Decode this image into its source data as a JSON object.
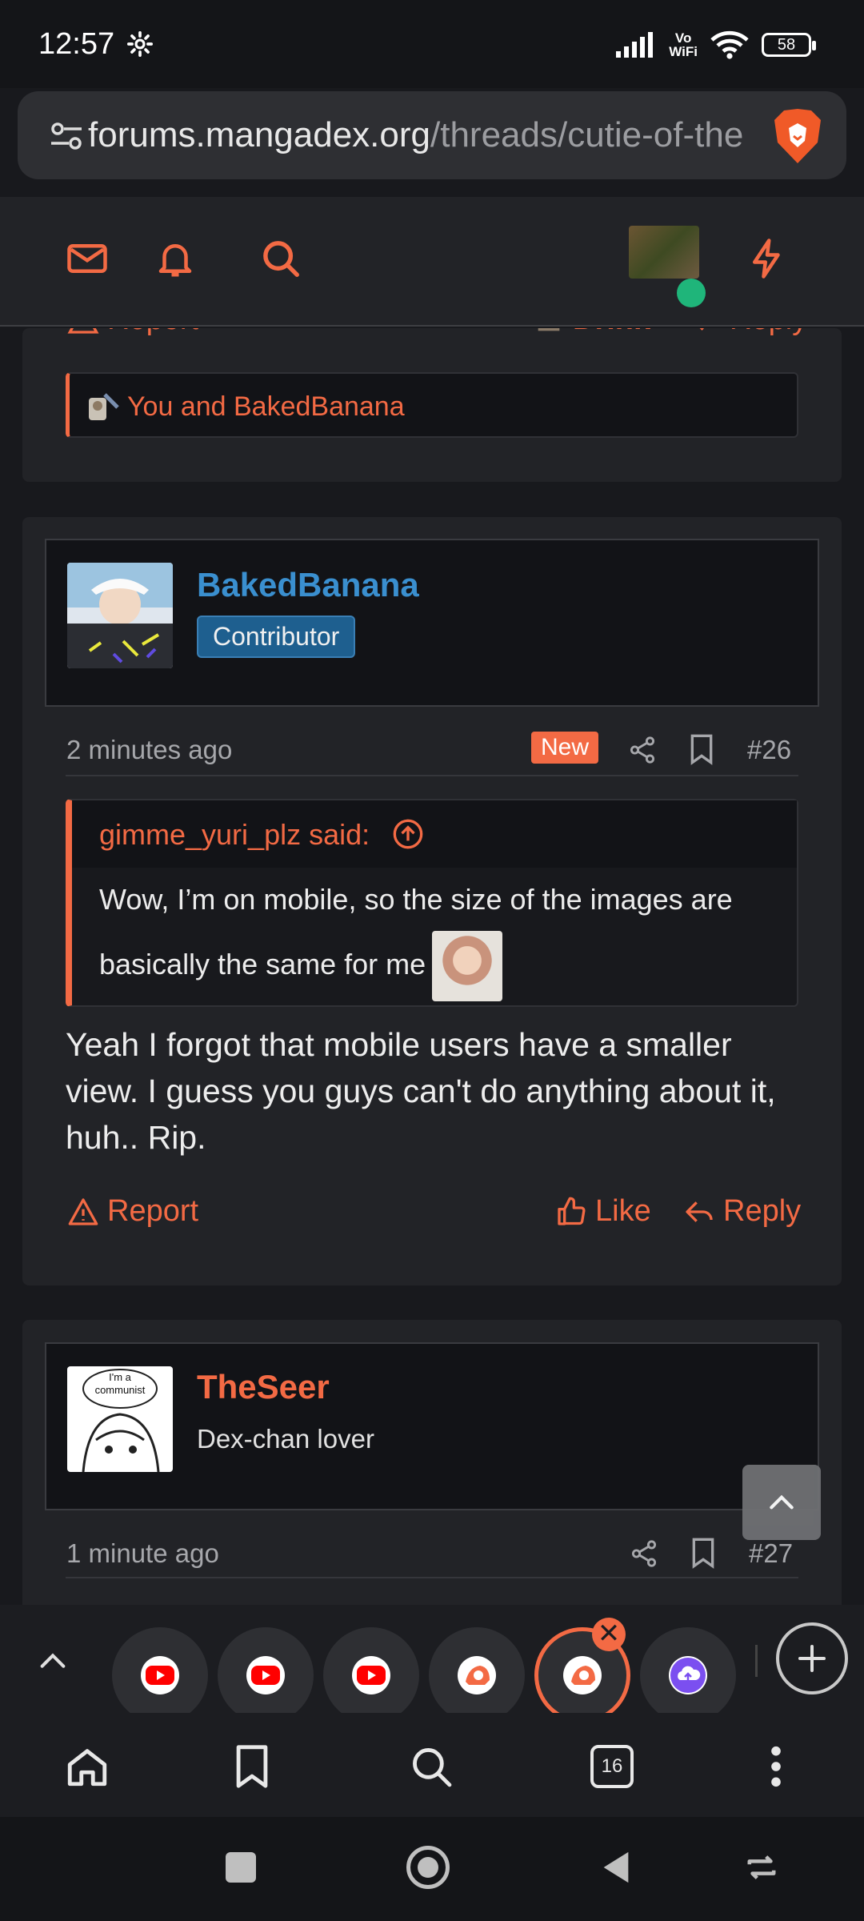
{
  "status_bar": {
    "time": "12:57",
    "network_label": "Vo\nWiFi",
    "battery": "58"
  },
  "browser": {
    "url_domain": "forums.mangadex.org",
    "url_path": "/threads/cutie-of-the"
  },
  "post_prev": {
    "actions": {
      "report": "Report",
      "drink": "Drink",
      "reply": "Reply"
    },
    "reactions": "You and BakedBanana"
  },
  "post_26": {
    "username": "BakedBanana",
    "badge": "Contributor",
    "time": "2 minutes ago",
    "new_label": "New",
    "number": "#26",
    "quote": {
      "author": "gimme_yuri_plz said:",
      "line1": "Wow, I’m on mobile, so the size of the images are",
      "line2": "basically the same for me"
    },
    "body": "Yeah I forgot that mobile users have a smaller view. I guess you guys can't do anything about it, huh.. Rip.",
    "actions": {
      "report": "Report",
      "like": "Like",
      "reply": "Reply"
    }
  },
  "post_27": {
    "username": "TheSeer",
    "user_title": "Dex-chan lover",
    "avatar_caption_1": "I'm a",
    "avatar_caption_2": "communist",
    "time": "1 minute ago",
    "number": "#27"
  },
  "tab_strip": {
    "open_tabs": [
      "youtube",
      "youtube",
      "youtube",
      "mangadex",
      "mangadex",
      "cloud-upload"
    ]
  },
  "bottom_bar": {
    "tab_count": "16"
  },
  "colors": {
    "accent": "#f36a44",
    "link_blue": "#3a8fcf",
    "background": "#18191d",
    "online": "#1fb57a"
  }
}
